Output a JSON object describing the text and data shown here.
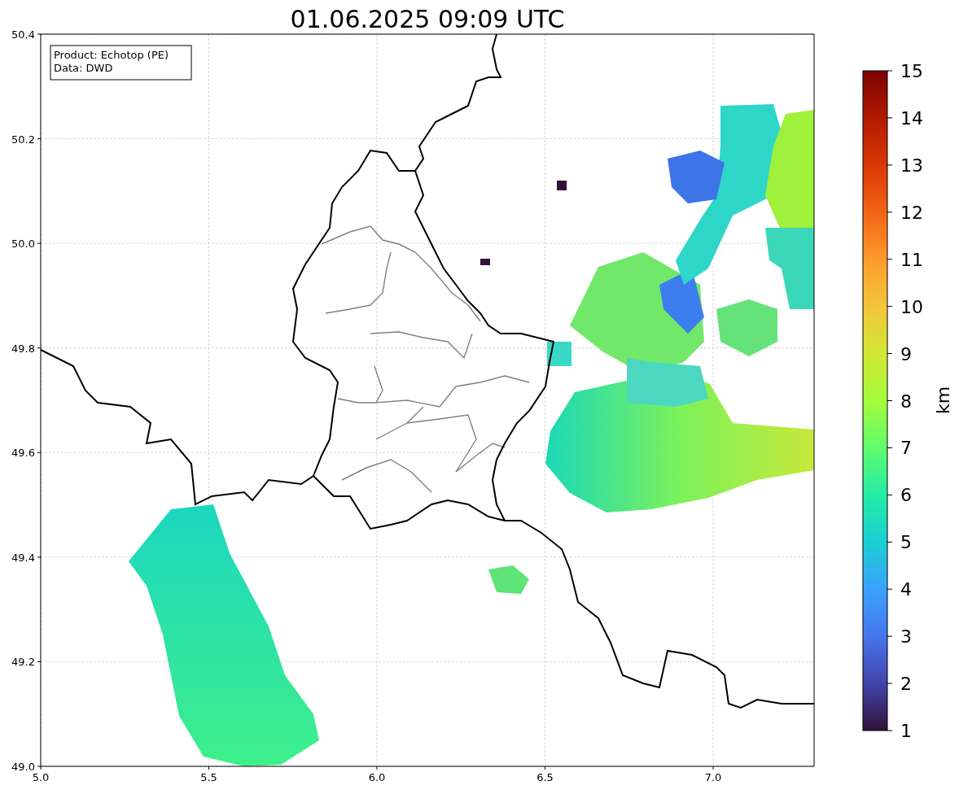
{
  "title": "01.06.2025 09:09 UTC",
  "info_box": [
    "Product: Echotop (PE)",
    "Data: DWD"
  ],
  "x_ticks": [
    "5.0",
    "5.5",
    "6.0",
    "6.5",
    "7.0"
  ],
  "y_ticks": [
    "50.4",
    "50.2",
    "50.0",
    "49.8",
    "49.6",
    "49.4",
    "49.2",
    "49.0"
  ],
  "colorbar": {
    "label": "km",
    "ticks": [
      "15",
      "14",
      "13",
      "12",
      "11",
      "10",
      "9",
      "8",
      "7",
      "6",
      "5",
      "4",
      "3",
      "2",
      "1"
    ]
  }
}
